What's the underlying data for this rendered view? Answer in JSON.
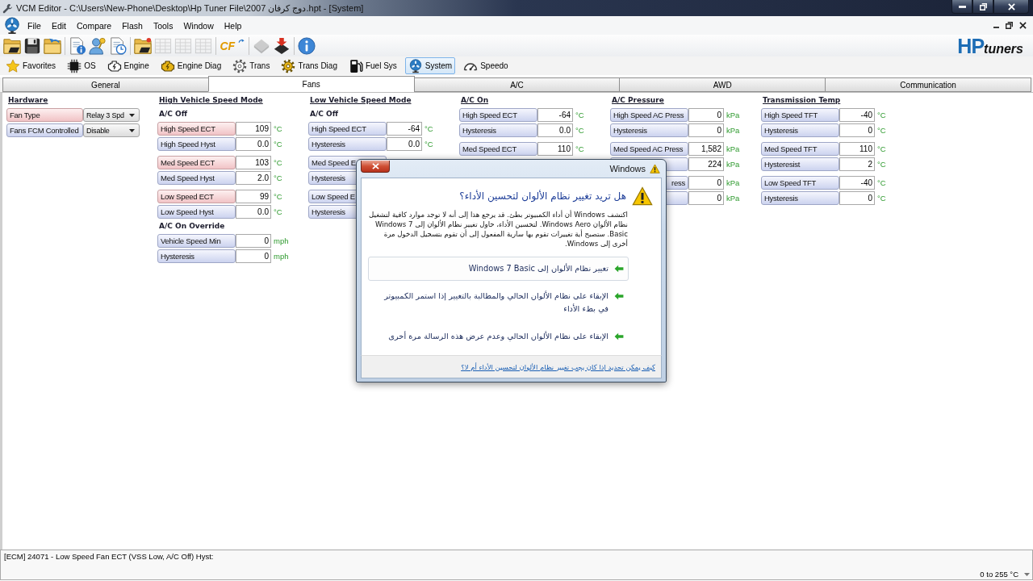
{
  "window": {
    "title": "VCM Editor - C:\\Users\\New-Phone\\Desktop\\Hp Tuner File\\2007 دوج كرفان.hpt - [System]"
  },
  "menu": [
    "File",
    "Edit",
    "Compare",
    "Flash",
    "Tools",
    "Window",
    "Help"
  ],
  "toolbar": [
    {
      "items": [
        {
          "kind": "open",
          "disabled": false
        },
        {
          "kind": "save",
          "disabled": false
        },
        {
          "kind": "reopen",
          "disabled": false
        }
      ]
    },
    {
      "items": [
        {
          "kind": "fileinfo",
          "disabled": false
        },
        {
          "kind": "license",
          "disabled": false
        },
        {
          "kind": "history",
          "disabled": false
        }
      ]
    },
    {
      "items": [
        {
          "kind": "load",
          "disabled": false
        },
        {
          "kind": "table",
          "disabled": true
        },
        {
          "kind": "table",
          "disabled": true
        },
        {
          "kind": "table",
          "disabled": true
        }
      ]
    },
    {
      "items": [
        {
          "kind": "compare",
          "text": "CF",
          "disabled": false
        }
      ]
    },
    {
      "items": [
        {
          "kind": "read",
          "disabled": true
        },
        {
          "kind": "write",
          "disabled": false
        }
      ]
    },
    {
      "items": [
        {
          "kind": "about",
          "disabled": false
        }
      ]
    }
  ],
  "logo": {
    "mark": "HP",
    "word": "tuners"
  },
  "nav": [
    {
      "kind": "favorites",
      "label": "Favorites",
      "selected": false
    },
    {
      "kind": "os",
      "label": "OS",
      "selected": false
    },
    {
      "kind": "engine",
      "label": "Engine",
      "selected": false
    },
    {
      "kind": "enginediag",
      "label": "Engine Diag",
      "selected": false
    },
    {
      "kind": "trans",
      "label": "Trans",
      "selected": false
    },
    {
      "kind": "transdiag",
      "label": "Trans Diag",
      "selected": false
    },
    {
      "kind": "fuel",
      "label": "Fuel Sys",
      "selected": false
    },
    {
      "kind": "system",
      "label": "System",
      "selected": true
    },
    {
      "kind": "speedo",
      "label": "Speedo",
      "selected": false
    }
  ],
  "tabs": [
    {
      "label": "General",
      "selected": false
    },
    {
      "label": "Fans",
      "selected": true
    },
    {
      "label": "A/C",
      "selected": false
    },
    {
      "label": "AWD",
      "selected": false
    },
    {
      "label": "Communication",
      "selected": false
    }
  ],
  "columns": [
    {
      "heading": "Hardware",
      "sections": [
        {
          "groups": [
            {
              "rows": [
                {
                  "kind": "dropdown",
                  "label": "Fan Type",
                  "value": "Relay 3 Spd",
                  "highlighted": true
                },
                {
                  "kind": "dropdown",
                  "label": "Fans FCM Controlled",
                  "value": "Disable",
                  "highlighted": false
                }
              ]
            }
          ]
        }
      ]
    },
    {
      "heading": "High Vehicle Speed Mode",
      "sections": [
        {
          "title": "A/C Off",
          "groups": [
            {
              "rows": [
                {
                  "kind": "number",
                  "label": "High Speed ECT",
                  "value": "109",
                  "unit": "°C",
                  "highlighted": true
                },
                {
                  "kind": "number",
                  "label": "High Speed Hyst",
                  "value": "0.0",
                  "unit": "°C",
                  "highlighted": false
                }
              ]
            },
            {
              "rows": [
                {
                  "kind": "number",
                  "label": "Med Speed ECT",
                  "value": "103",
                  "unit": "°C",
                  "highlighted": true
                },
                {
                  "kind": "number",
                  "label": "Med Speed Hyst",
                  "value": "2.0",
                  "unit": "°C",
                  "highlighted": false
                }
              ]
            },
            {
              "rows": [
                {
                  "kind": "number",
                  "label": "Low Speed ECT",
                  "value": "99",
                  "unit": "°C",
                  "highlighted": true
                },
                {
                  "kind": "number",
                  "label": "Low Speed Hyst",
                  "value": "0.0",
                  "unit": "°C",
                  "highlighted": false
                }
              ]
            }
          ]
        },
        {
          "title": "A/C On Override",
          "groups": [
            {
              "rows": [
                {
                  "kind": "number",
                  "label": "Vehicle Speed Min",
                  "value": "0",
                  "unit": "mph",
                  "highlighted": false
                },
                {
                  "kind": "number",
                  "label": "Hysteresis",
                  "value": "0",
                  "unit": "mph",
                  "highlighted": false
                }
              ]
            }
          ]
        }
      ]
    },
    {
      "heading": "Low Vehicle Speed Mode",
      "sections": [
        {
          "title": "A/C Off",
          "groups": [
            {
              "rows": [
                {
                  "kind": "number",
                  "label": "High Speed ECT",
                  "value": "-64",
                  "unit": "°C",
                  "highlighted": false
                },
                {
                  "kind": "number",
                  "label": "Hysteresis",
                  "value": "0.0",
                  "unit": "°C",
                  "highlighted": false
                }
              ]
            },
            {
              "rows": [
                {
                  "kind": "number",
                  "label": "Med Speed E",
                  "highlighted": false
                },
                {
                  "kind": "number",
                  "label": "Hysteresis",
                  "highlighted": false
                }
              ]
            },
            {
              "rows": [
                {
                  "kind": "number",
                  "label": "Low Speed E",
                  "highlighted": false
                },
                {
                  "kind": "number",
                  "label": "Hysteresis",
                  "highlighted": false
                }
              ]
            }
          ]
        }
      ]
    },
    {
      "heading": "A/C On",
      "sections": [
        {
          "groups": [
            {
              "rows": [
                {
                  "kind": "number",
                  "label": "High Speed ECT",
                  "value": "-64",
                  "unit": "°C",
                  "highlighted": false
                },
                {
                  "kind": "number",
                  "label": "Hysteresis",
                  "value": "0.0",
                  "unit": "°C",
                  "highlighted": false
                }
              ]
            },
            {
              "rows": [
                {
                  "kind": "number",
                  "label": "Med Speed ECT",
                  "value": "110",
                  "unit": "°C",
                  "highlighted": false
                }
              ]
            }
          ]
        }
      ]
    },
    {
      "heading": "A/C Pressure",
      "sections": [
        {
          "groups": [
            {
              "rows": [
                {
                  "kind": "number",
                  "label": "High Speed AC Press",
                  "value": "0",
                  "unit": "kPa",
                  "highlighted": false
                },
                {
                  "kind": "number",
                  "label": "Hysteresis",
                  "value": "0",
                  "unit": "kPa",
                  "highlighted": false
                }
              ]
            },
            {
              "rows": [
                {
                  "kind": "number",
                  "label": "Med Speed AC Press",
                  "value": "1,582",
                  "unit": "kPa",
                  "highlighted": false
                },
                {
                  "kind": "number",
                  "value": "224",
                  "unit": "kPa",
                  "highlighted": false
                }
              ]
            },
            {
              "rows": [
                {
                  "kind": "number",
                  "label": "ress",
                  "label_clipped": true,
                  "value": "0",
                  "unit": "kPa",
                  "highlighted": false
                },
                {
                  "kind": "number",
                  "value": "0",
                  "unit": "kPa",
                  "highlighted": false
                }
              ]
            }
          ]
        }
      ]
    },
    {
      "heading": "Transmission Temp",
      "sections": [
        {
          "groups": [
            {
              "rows": [
                {
                  "kind": "number",
                  "label": "High Speed TFT",
                  "value": "-40",
                  "unit": "°C",
                  "highlighted": false
                },
                {
                  "kind": "number",
                  "label": "Hysteresis",
                  "value": "0",
                  "unit": "°C",
                  "highlighted": false
                }
              ]
            },
            {
              "rows": [
                {
                  "kind": "number",
                  "label": "Med Speed TFT",
                  "value": "110",
                  "unit": "°C",
                  "highlighted": false
                },
                {
                  "kind": "number",
                  "label": "Hysteresist",
                  "value": "2",
                  "unit": "°C",
                  "highlighted": false
                }
              ]
            },
            {
              "rows": [
                {
                  "kind": "number",
                  "label": "Low Speed TFT",
                  "value": "-40",
                  "unit": "°C",
                  "highlighted": false
                },
                {
                  "kind": "number",
                  "label": "Hysteresis",
                  "value": "0",
                  "unit": "°C",
                  "highlighted": false
                }
              ]
            }
          ]
        }
      ]
    }
  ],
  "dialog": {
    "title": "Windows",
    "heading": "هل تريد تغيير نظام الألوان لتحسين الأداء؟",
    "message": "اكتشف Windows أن أداء الكمبيوتر بطئ. قد يرجع هذا إلى أنه لا توجد موارد كافية لتشغيل نظام الألوان Windows Aero. لتحسين الأداء، حاول تغيير نظام الألوان إلى Windows 7 Basic. ستصبح أية تغييرات تقوم بها سارية المفعول إلى أن تقوم بتسجيل الدخول مرة أخرى إلى Windows.",
    "options": [
      {
        "label": "تغيير نظام الألوان إلى Windows 7 Basic",
        "selected": true
      },
      {
        "label": "الإبقاء على نظام الألوان الحالي والمطالبة بالتغيير إذا استمر الكمبيوتر في بطء الأداء",
        "selected": false
      },
      {
        "label": "الإبقاء على نظام الألوان الحالي وعدم عرض هذه الرسالة مرة أخرى",
        "selected": false
      }
    ],
    "link": "كيف يمكن تحديد إذا كان يجب تغيير نظام الألوان لتحسين الأداء أم لا؟"
  },
  "status": {
    "description": "[ECM] 24071 - Low Speed Fan ECT (VSS Low, A/C Off) Hyst:",
    "range": "0 to 255 °C"
  }
}
